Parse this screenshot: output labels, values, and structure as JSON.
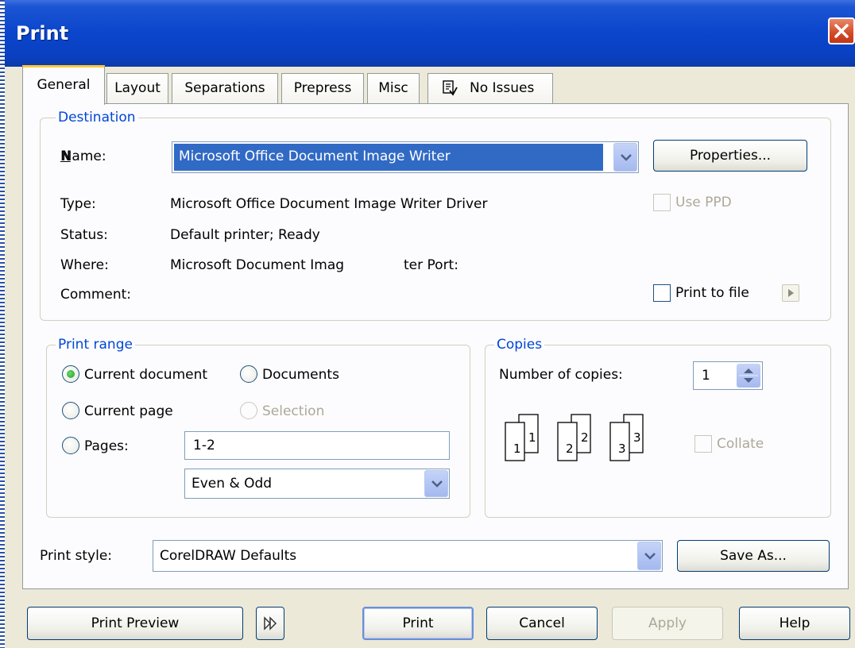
{
  "dialog": {
    "title": "Print"
  },
  "tabs": [
    {
      "label": "General"
    },
    {
      "label": "Layout"
    },
    {
      "label": "Separations"
    },
    {
      "label": "Prepress"
    },
    {
      "label": "Misc"
    },
    {
      "label": "No Issues"
    }
  ],
  "destination": {
    "group_label": "Destination",
    "name_label": "Name:",
    "name_value": "Microsoft Office Document Image Writer",
    "properties_button": "Properties...",
    "type_label": "Type:",
    "type_value": "Microsoft Office Document Image Writer Driver",
    "status_label": "Status:",
    "status_value": "Default printer; Ready",
    "where_label": "Where:",
    "where_value_a": "Microsoft Document Imag",
    "where_value_b": "ter Port:",
    "comment_label": "Comment:",
    "use_ppd_label": "Use PPD",
    "use_ppd_checked": false,
    "print_to_file_label": "Print to file",
    "print_to_file_checked": false
  },
  "print_range": {
    "group_label": "Print range",
    "current_document": "Current document",
    "documents": "Documents",
    "current_page": "Current page",
    "selection": "Selection",
    "pages": "Pages:",
    "pages_value": "1-2",
    "page_set_value": "Even & Odd",
    "selected": "current_document"
  },
  "copies": {
    "group_label": "Copies",
    "number_label": "Number of copies:",
    "number_value": "1",
    "collate_label": "Collate",
    "collate_checked": false,
    "illustration_pages": [
      "1",
      "1",
      "2",
      "2",
      "3",
      "3"
    ]
  },
  "print_style": {
    "label": "Print style:",
    "value": "CorelDRAW Defaults",
    "save_as_button": "Save As..."
  },
  "bottom_buttons": {
    "print_preview": "Print Preview",
    "print": "Print",
    "cancel": "Cancel",
    "apply": "Apply",
    "help": "Help"
  },
  "colors": {
    "title_bar": "#0a45cc",
    "group_label": "#0046d5",
    "selection_highlight": "#316ac5",
    "active_tab_accent": "#ffc83c"
  }
}
